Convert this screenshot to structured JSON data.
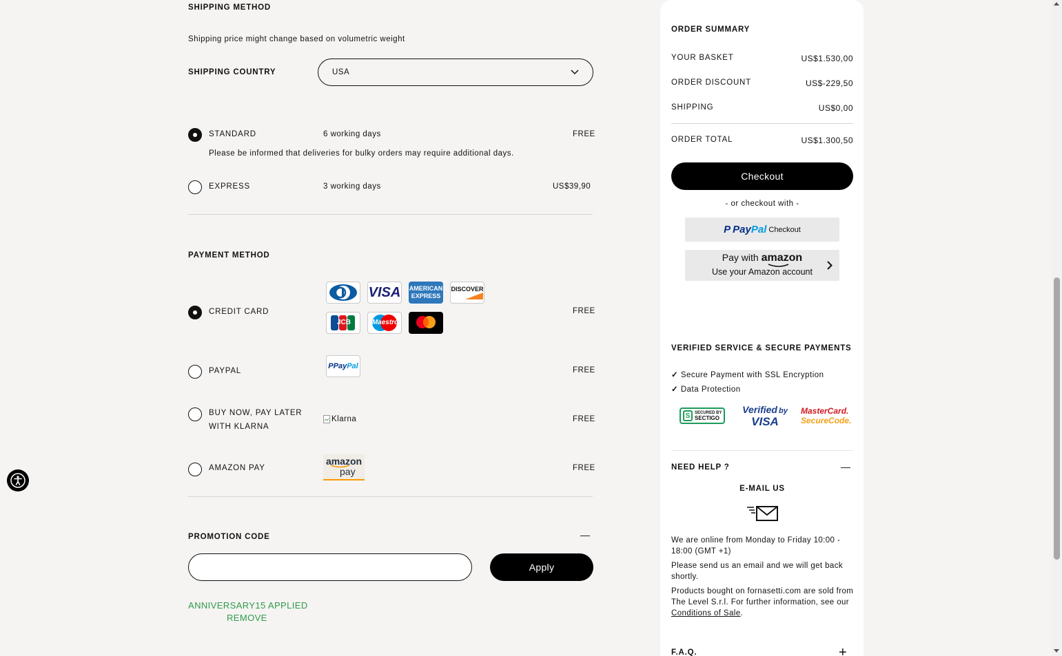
{
  "shipping": {
    "title": "SHIPPING METHOD",
    "note": "Shipping price might change based on volumetric weight",
    "country_label": "SHIPPING COUNTRY",
    "country_value": "USA",
    "options": [
      {
        "name": "STANDARD",
        "duration": "6 working days",
        "price": "FREE",
        "selected": true,
        "note": "Please be informed that deliveries for bulky orders may require additional days."
      },
      {
        "name": "EXPRESS",
        "duration": "3 working days",
        "price": "US$39,90",
        "selected": false
      }
    ]
  },
  "payment": {
    "title": "PAYMENT METHOD",
    "options": [
      {
        "name": "CREDIT CARD",
        "price": "FREE",
        "selected": true
      },
      {
        "name": "PAYPAL",
        "price": "FREE",
        "selected": false
      },
      {
        "name_line1": "BUY NOW, PAY LATER",
        "name_line2": "WITH KLARNA",
        "price": "FREE",
        "selected": false,
        "logo_alt": "Klarna"
      },
      {
        "name": "AMAZON PAY",
        "price": "FREE",
        "selected": false
      }
    ],
    "card_logos": {
      "visa": "VISA",
      "amex_1": "AMERICAN",
      "amex_2": "EXPRESS",
      "discover": "DISCOVER",
      "jcb": "JCB",
      "maestro": "Maestro",
      "paypal_logo_p": "P",
      "paypal_logo_1": "Pay",
      "paypal_logo_2": "Pal",
      "amazon_1": "amazon",
      "amazon_2": "pay"
    }
  },
  "promo": {
    "title": "PROMOTION CODE",
    "toggle": "—",
    "input_value": "",
    "apply": "Apply",
    "applied": "ANNIVERSARY15 APPLIED",
    "remove": "REMOVE"
  },
  "summary": {
    "title": "ORDER SUMMARY",
    "rows": [
      {
        "label": "YOUR BASKET",
        "value": "US$1.530,00"
      },
      {
        "label": "ORDER DISCOUNT",
        "value": "US$-229,50"
      },
      {
        "label": "SHIPPING",
        "value": "US$0,00"
      }
    ],
    "total_label": "ORDER TOTAL",
    "total_value": "US$1.300,50",
    "checkout": "Checkout",
    "or_checkout": "- or checkout with -",
    "paypal_checkout": {
      "p": "P",
      "pay": "Pay",
      "pal": "Pal",
      "checkout": "Checkout"
    },
    "amazon_pay": {
      "line1_a": "Pay with ",
      "line1_b": "amazon",
      "line2": "Use your Amazon account"
    }
  },
  "secure": {
    "title": "VERIFIED SERVICE & SECURE PAYMENTS",
    "items": [
      "Secure Payment with SSL Encryption",
      "Data Protection"
    ],
    "badges": {
      "sectigo_1": "SECURED BY",
      "sectigo_2": "SECTIGO",
      "verified_1": "Verified",
      "verified_by": "by",
      "verified_2": "VISA",
      "mc_1": "MasterCard.",
      "mc_2": "SecureCode."
    }
  },
  "help": {
    "title": "NEED HELP ?",
    "toggle": "—",
    "email_title": "E-MAIL US",
    "p1": "We are online from Monday to Friday 10:00 - 18:00 (GMT +1)",
    "p2": "Please send us an email and we will get back shortly.",
    "p3_before": "Products bought on fornasetti.com are sold from The Level S.r.l. For further information, see our ",
    "p3_link": "Conditions of Sale",
    "p3_after": "."
  },
  "faq": {
    "title": "F.A.Q.",
    "toggle": "+"
  },
  "colors": {
    "accent": "#000000",
    "success": "#2f9a4b",
    "background": "#f5f4f2"
  }
}
